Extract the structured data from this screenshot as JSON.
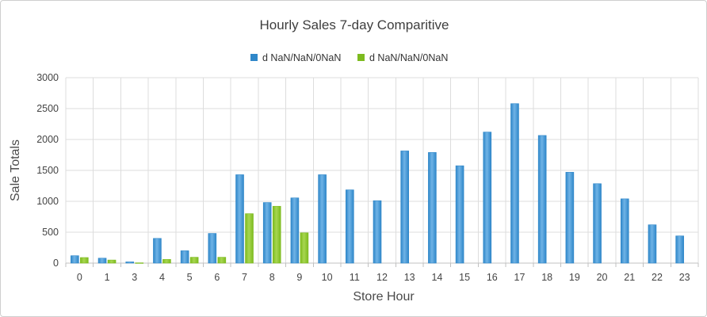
{
  "chart_data": {
    "type": "bar",
    "title": "Hourly Sales 7-day Comparitive",
    "xlabel": "Store Hour",
    "ylabel": "Sale Totals",
    "ylim": [
      0,
      3000
    ],
    "yticks": [
      0,
      500,
      1000,
      1500,
      2000,
      2500,
      3000
    ],
    "categories": [
      "0",
      "1",
      "3",
      "4",
      "5",
      "6",
      "7",
      "8",
      "9",
      "10",
      "11",
      "12",
      "13",
      "14",
      "15",
      "16",
      "17",
      "18",
      "19",
      "20",
      "21",
      "22",
      "23"
    ],
    "series": [
      {
        "name": "d NaN/NaN/0NaN",
        "color": "#2f87c9",
        "values": [
          120,
          80,
          20,
          400,
          200,
          480,
          1430,
          980,
          1055,
          1430,
          1185,
          1010,
          1815,
          1790,
          1575,
          2120,
          2580,
          2065,
          1470,
          1285,
          1040,
          620,
          440
        ]
      },
      {
        "name": "d NaN/NaN/0NaN",
        "color": "#7dbb1f",
        "values": [
          90,
          50,
          5,
          60,
          95,
          95,
          800,
          920,
          490,
          0,
          0,
          0,
          0,
          0,
          0,
          0,
          0,
          0,
          0,
          0,
          0,
          0,
          0
        ]
      }
    ],
    "legend_position": "top-center",
    "grid": true
  }
}
